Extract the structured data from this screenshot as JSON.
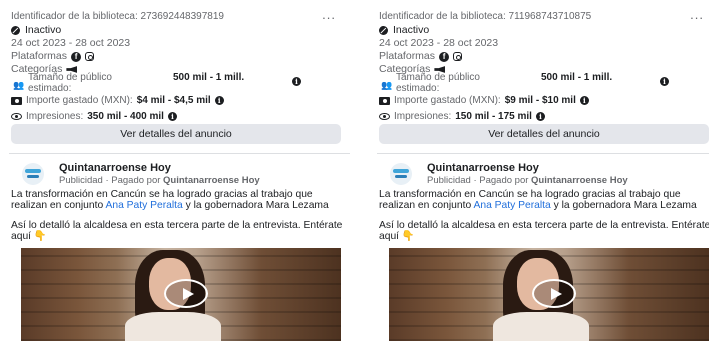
{
  "ads": [
    {
      "library_id": "Identificador de la biblioteca: 273692448397819",
      "more": "...",
      "status": "Inactivo",
      "dates": "24 oct 2023 - 28 oct 2023",
      "platforms_label": "Plataformas",
      "categories_label": "Categorías",
      "audience_label": "Tamaño de público estimado:",
      "audience_value": "500 mil - 1 mill.",
      "spend_label": "Importe gastado (MXN):",
      "spend_value": "$4 mil - $4,5 mil",
      "impressions_label": "Impresiones:",
      "impressions_value": "350 mil - 400 mil",
      "details_button": "Ver detalles del anuncio",
      "page_name": "Quintanarroense Hoy",
      "sponsored_prefix": "Publicidad · Pagado por",
      "sponsored_by": "Quintanarroense Hoy",
      "body_1_a": "La transformación en Cancún se ha logrado gracias al trabajo que realizan en conjunto",
      "body_1_mention": "Ana Paty Peralta",
      "body_1_b": "y la gobernadora Mara Lezama",
      "body_2": "Así lo detalló la alcaldesa en esta tercera parte de la entrevista. Entérate aquí",
      "body_2_emoji": "👇"
    },
    {
      "library_id": "Identificador de la biblioteca: 711968743710875",
      "more": "...",
      "status": "Inactivo",
      "dates": "24 oct 2023 - 28 oct 2023",
      "platforms_label": "Plataformas",
      "categories_label": "Categorías",
      "audience_label": "Tamaño de público estimado:",
      "audience_value": "500 mil - 1 mill.",
      "spend_label": "Importe gastado (MXN):",
      "spend_value": "$9 mil - $10 mil",
      "impressions_label": "Impresiones:",
      "impressions_value": "150 mil - 175 mil",
      "details_button": "Ver detalles del anuncio",
      "page_name": "Quintanarroense Hoy",
      "sponsored_prefix": "Publicidad · Pagado por",
      "sponsored_by": "Quintanarroense Hoy",
      "body_1_a": "La transformación en Cancún se ha logrado gracias al trabajo que realizan en conjunto",
      "body_1_mention": "Ana Paty Peralta",
      "body_1_b": "y la gobernadora Mara Lezama",
      "body_2": "Así lo detalló la alcaldesa en esta tercera parte de la entrevista. Entérate aquí",
      "body_2_emoji": "👇"
    }
  ],
  "icons": {
    "status": "inactive-icon",
    "platforms": [
      "facebook-icon",
      "instagram-icon"
    ],
    "categories": "megaphone-icon",
    "audience": "people-icon",
    "spend": "money-icon",
    "impressions": "eye-icon",
    "info": "info-icon",
    "play": "play-icon"
  },
  "colors": {
    "mention": "#216fdb",
    "button_bg": "#e4e6eb",
    "muted_text": "#65676b"
  }
}
